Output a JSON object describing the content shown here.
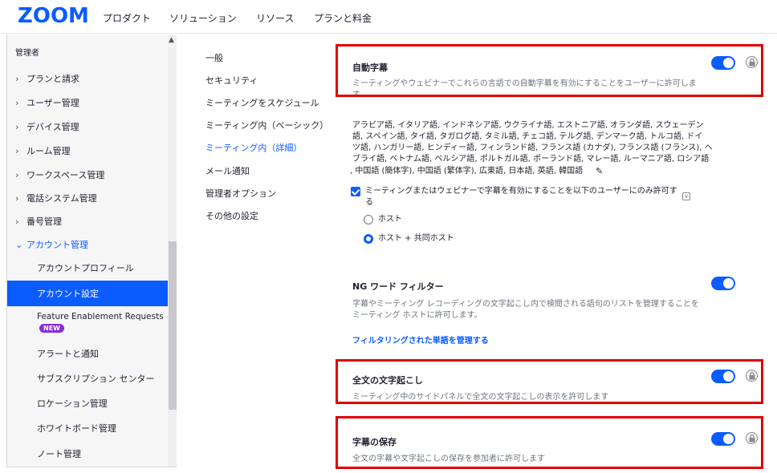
{
  "topnav": {
    "logo": "ZOOM",
    "items": [
      "プロダクト",
      "ソリューション",
      "リソース",
      "プランと料金"
    ]
  },
  "sidebar": {
    "section": "管理者",
    "items": [
      {
        "label": "プランと請求"
      },
      {
        "label": "ユーザー管理"
      },
      {
        "label": "デバイス管理"
      },
      {
        "label": "ルーム管理"
      },
      {
        "label": "ワークスペース管理"
      },
      {
        "label": "電話システム管理"
      },
      {
        "label": "番号管理"
      },
      {
        "label": "アカウント管理"
      }
    ],
    "subitems": [
      {
        "label": "アカウントプロフィール"
      },
      {
        "label": "アカウント設定"
      },
      {
        "label": "Feature Enablement Requests"
      },
      {
        "label": "アラートと通知"
      },
      {
        "label": "サブスクリプション センター"
      },
      {
        "label": "ロケーション管理"
      },
      {
        "label": "ホワイトボード管理"
      },
      {
        "label": "ノート管理"
      }
    ],
    "new_badge": "NEW"
  },
  "midnav": {
    "items": [
      "一般",
      "セキュリティ",
      "ミーティングをスケジュール",
      "ミーティング内（ベーシック）",
      "ミーティング内（詳細）",
      "メール通知",
      "管理者オプション",
      "その他の設定"
    ]
  },
  "settings": {
    "auto_caption": {
      "title": "自動字幕",
      "desc": "ミーティングやウェビナーでこれらの言語での自動字幕を有効にすることをユーザーに許可しま",
      "desc_tail": "す。",
      "languages": [
        "アラビア語, イタリア語, インドネシア語, ウクライナ語, エストニア語, オランダ語, スウェーデン",
        "語, スペイン語, タイ語, タガログ語, タミル語, チェコ語, テルグ語, デンマーク語, トルコ語, ドイ",
        "ツ語, ハンガリー語, ヒンディー語, フィンランド語, フランス語 (カナダ), フランス語 (フランス), ヘ",
        "ブライ語, ベトナム語, ベルシア語, ポルトガル語, ポーランド語, マレー語, ルーマニア語, ロシア語",
        ", 中国語 (簡体字), 中国語 (繁体字), 広東語, 日本語, 英語, 韓国語"
      ],
      "checkbox_label": "ミーティングまたはウェビナーで字幕を有効にすることを以下のユーザーにのみ許可す",
      "checkbox_label_tail": "る",
      "radio_host": "ホスト",
      "radio_cohost": "ホスト + 共同ホスト"
    },
    "ng_filter": {
      "title": "NG ワード フィルター",
      "desc1": "字幕やミーティング レコーディングの文字起こし内で検閲される語句のリストを管理することを",
      "desc2": "ミーティング ホストに許可します。",
      "link": "フィルタリングされた単語を管理する"
    },
    "full_transcript": {
      "title": "全文の文字起こし",
      "desc": "ミーティング中のサイドパネルで全文の文字起こしの表示を許可します"
    },
    "save_caption": {
      "title": "字幕の保存",
      "desc": "全文の字幕や文字起こしの保存を参加者に許可します"
    }
  },
  "colors": {
    "accent": "#0b5cff",
    "highlight_box": "#e00000",
    "new_badge": "#8a2bd8"
  }
}
